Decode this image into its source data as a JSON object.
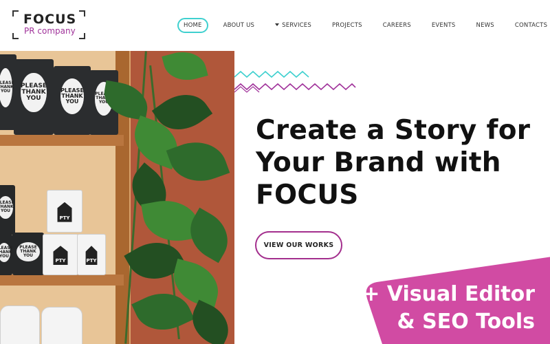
{
  "brand": {
    "logo_word": "FOCUS",
    "logo_sub": "PR company",
    "accent": "#a0329a",
    "nav_highlight": "#3fd0cf"
  },
  "nav": {
    "items": [
      {
        "label": "HOME",
        "active": true
      },
      {
        "label": "ABOUT US"
      },
      {
        "label": "SERVICES",
        "has_dropdown": true
      },
      {
        "label": "PROJECTS"
      },
      {
        "label": "CAREERS"
      },
      {
        "label": "EVENTS"
      },
      {
        "label": "NEWS"
      },
      {
        "label": "CONTACTS"
      }
    ]
  },
  "photo": {
    "bag_label": "PLEASE THANK YOU",
    "cup_label": "PTY"
  },
  "hero": {
    "title": "Create a Story for Your Brand with FOCUS",
    "cta_label": "VIEW OUR WORKS"
  },
  "promo": {
    "line1": "+ Visual Editor",
    "line2": "& SEO Tools",
    "color": "#d14ba3"
  }
}
